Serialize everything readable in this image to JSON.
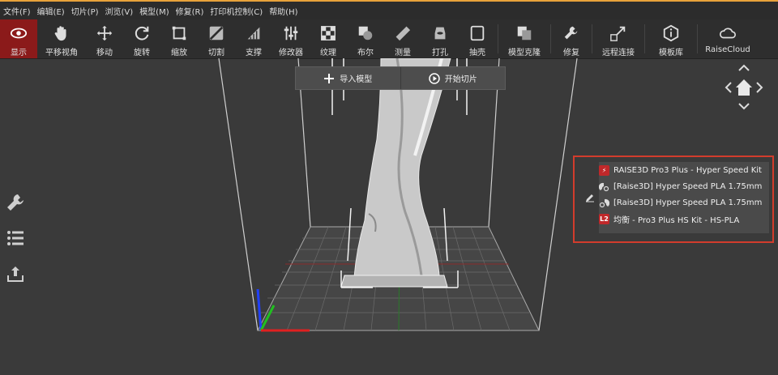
{
  "menu": [
    "文件(F)",
    "编辑(E)",
    "切片(P)",
    "浏览(V)",
    "模型(M)",
    "修复(R)",
    "打印机控制(C)",
    "帮助(H)"
  ],
  "toolbar": [
    {
      "label": "显示",
      "icon": "eye-icon",
      "active": true
    },
    {
      "label": "平移视角",
      "icon": "hand-icon"
    },
    {
      "label": "移动",
      "icon": "move-arrows-icon"
    },
    {
      "label": "旋转",
      "icon": "rotate-icon"
    },
    {
      "label": "缩放",
      "icon": "scale-icon"
    },
    {
      "label": "切割",
      "icon": "cut-icon"
    },
    {
      "label": "支撑",
      "icon": "support-icon"
    },
    {
      "label": "修改器",
      "icon": "modifier-sliders-icon"
    },
    {
      "label": "纹理",
      "icon": "texture-checker-icon"
    },
    {
      "label": "布尔",
      "icon": "boolean-icon"
    },
    {
      "label": "测量",
      "icon": "ruler-icon"
    },
    {
      "label": "打孔",
      "icon": "hole-icon"
    },
    {
      "label": "抽壳",
      "icon": "shell-icon"
    },
    {
      "label": "模型克隆",
      "icon": "clone-icon"
    },
    {
      "label": "修复",
      "icon": "repair-wrench-icon"
    },
    {
      "label": "远程连接",
      "icon": "remote-connect-icon"
    },
    {
      "label": "模板库",
      "icon": "template-library-icon"
    },
    {
      "label": "RaiseCloud",
      "icon": "cloud-icon"
    }
  ],
  "actions": {
    "import": "导入模型",
    "slice": "开始切片"
  },
  "profile": {
    "printer": "RAISE3D Pro3 Plus - Hyper Speed Kit",
    "material_left": "[Raise3D] Hyper Speed PLA 1.75mm",
    "material_right": "[Raise3D] Hyper Speed PLA 1.75mm",
    "quality_badge": "L2",
    "quality": "均衡 - Pro3 Plus HS Kit - HS-PLA"
  },
  "colors": {
    "accent": "#e8a23a",
    "active": "#8b1a1a",
    "highlight": "#d23c2c",
    "axis_x": "#e02020",
    "axis_y": "#20c020",
    "axis_z": "#2040ff"
  }
}
